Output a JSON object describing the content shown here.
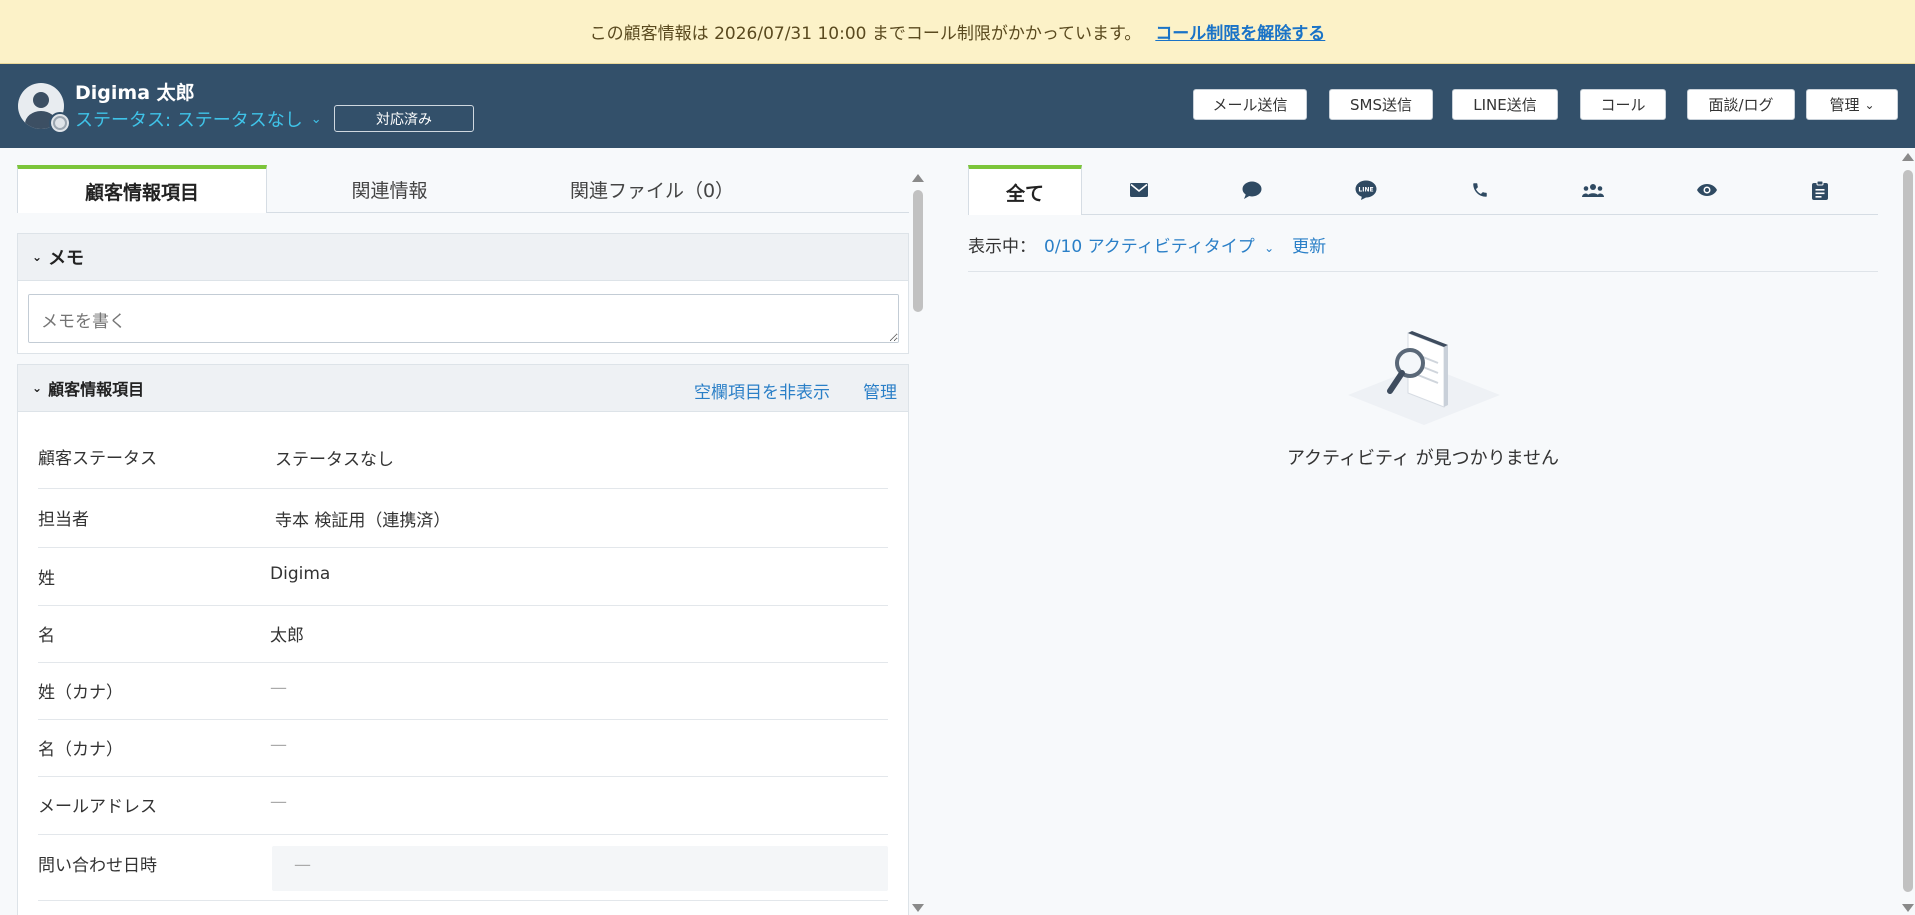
{
  "banner": {
    "message": "この顧客情報は 2026/07/31 10:00 までコール制限がかかっています。",
    "link": "コール制限を解除する"
  },
  "header": {
    "name": "Digima 太郎",
    "status": "ステータス: ステータスなし",
    "handled_button": "対応済み",
    "actions": [
      "メール送信",
      "SMS送信",
      "LINE送信",
      "コール",
      "面談/ログ",
      "管理"
    ]
  },
  "left": {
    "tabs": [
      "顧客情報項目",
      "関連情報",
      "関連ファイル（0）"
    ],
    "memo": {
      "title": "メモ",
      "placeholder": "メモを書く"
    },
    "info": {
      "title": "顧客情報項目",
      "hide_empty": "空欄項目を非表示",
      "manage": "管理",
      "rows": [
        {
          "label": "顧客ステータス",
          "value": "ステータスなし"
        },
        {
          "label": "担当者",
          "value": "寺本 検証用（連携済）"
        },
        {
          "label": "姓",
          "value": "Digima"
        },
        {
          "label": "名",
          "value": "太郎"
        },
        {
          "label": "姓（カナ）",
          "value": "—"
        },
        {
          "label": "名（カナ）",
          "value": "—"
        },
        {
          "label": "メールアドレス",
          "value": "—"
        },
        {
          "label": "問い合わせ日時",
          "value": "—"
        }
      ]
    }
  },
  "right": {
    "tab_all": "全て",
    "tab_icons": [
      "mail-icon",
      "chat-icon",
      "line-icon",
      "phone-icon",
      "meeting-icon",
      "view-icon",
      "clipboard-icon"
    ],
    "filter_label": "表示中：",
    "filter_value": "0/10 アクティビティタイプ",
    "refresh": "更新",
    "empty_message": "アクティビティ が見つかりません"
  },
  "colors": {
    "banner_bg": "#fcf2c8",
    "header_bg": "#33506a",
    "accent_green": "#7cc53a",
    "link_blue": "#2a7fc7",
    "status_cyan": "#3fc3e8"
  }
}
